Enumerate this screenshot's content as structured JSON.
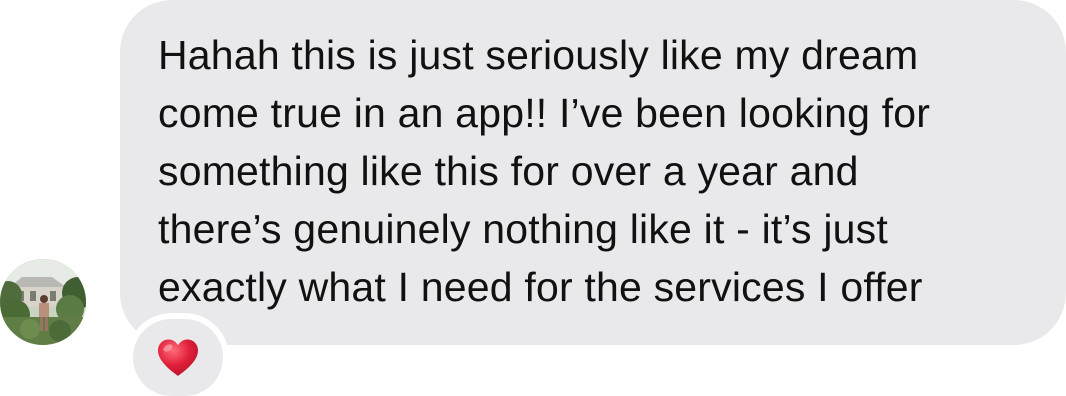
{
  "avatar": {
    "icon": "user-photo-avatar"
  },
  "message": {
    "lines": [
      "Hahah this is just seriously like my dream",
      "come true in an app!! I’ve been looking for",
      "something like this for over a year and",
      "there’s genuinely nothing like it - it’s just",
      "exactly what I need for the services I offer"
    ]
  },
  "reaction": {
    "icon": "red-heart-icon",
    "color": "#e0203a"
  },
  "colors": {
    "bubble": "#e9e9eb",
    "text": "#111111",
    "background": "#ffffff"
  }
}
